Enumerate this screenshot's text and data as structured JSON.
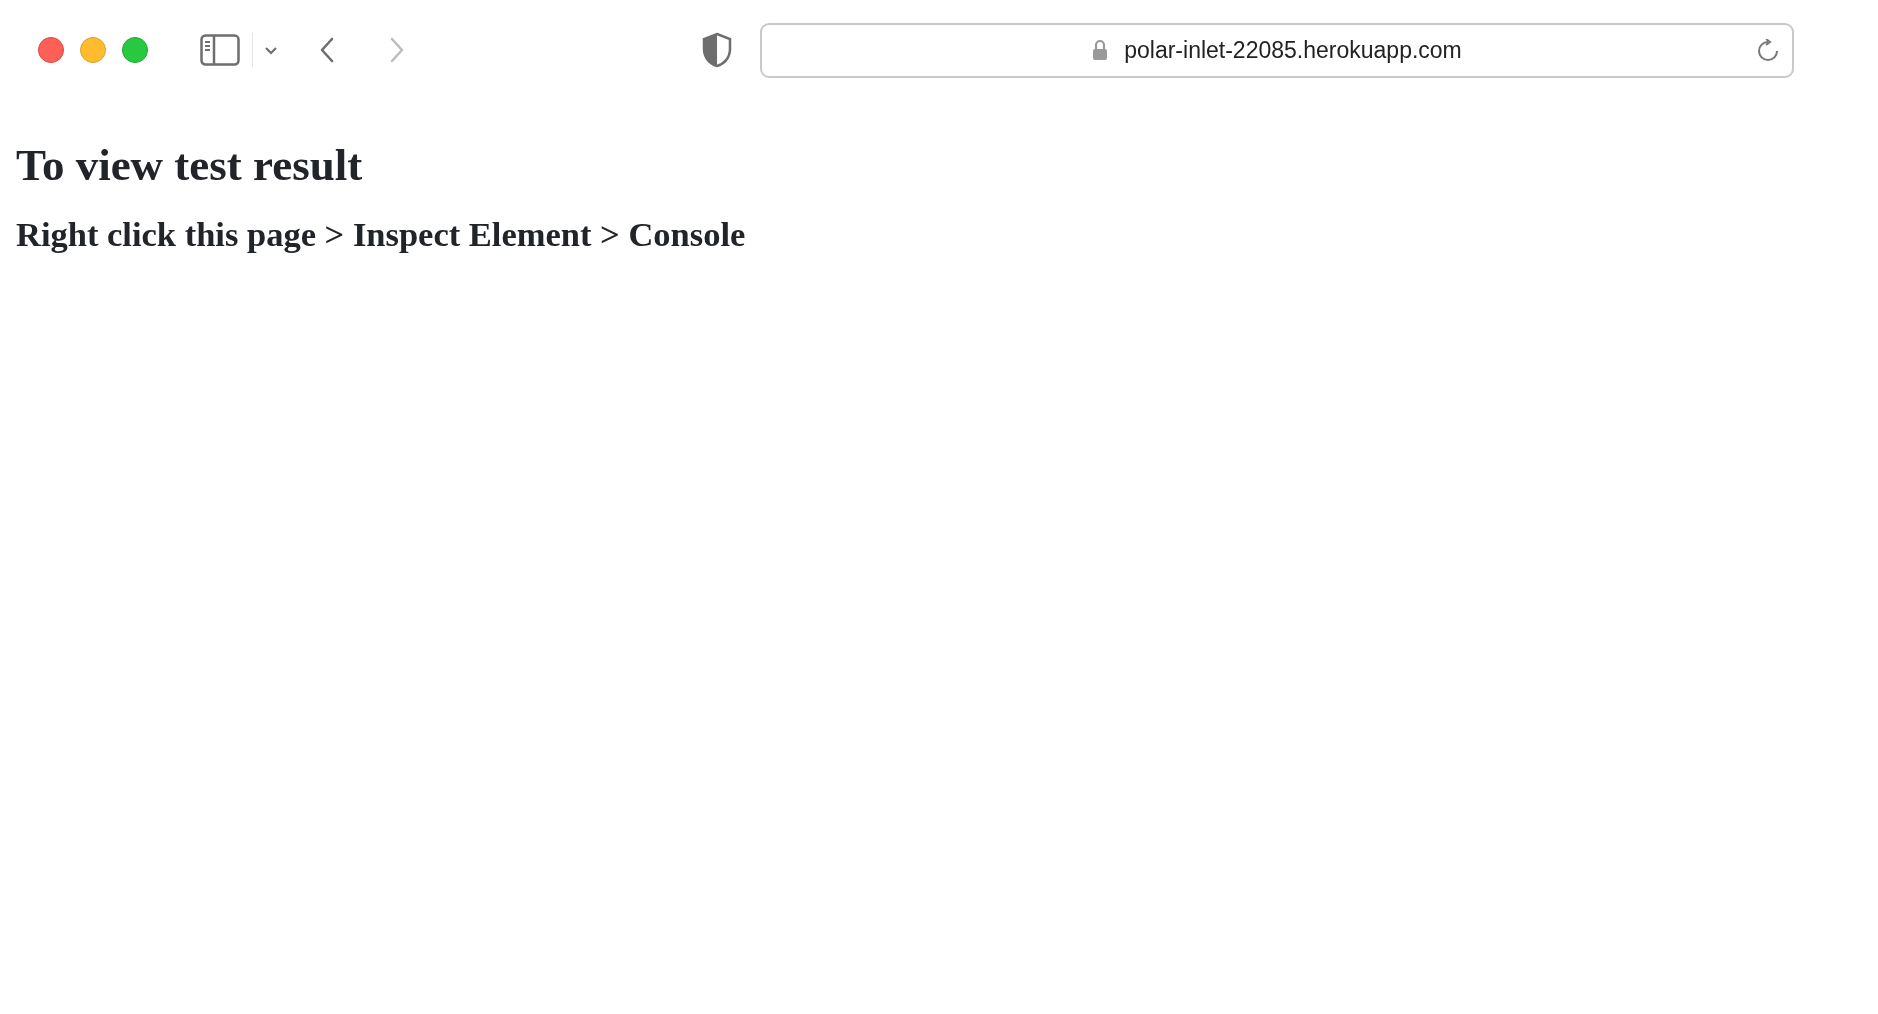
{
  "toolbar": {
    "nav_buttons": [
      {
        "kind": "back",
        "disabled": false
      },
      {
        "kind": "forward",
        "disabled": true
      }
    ],
    "address": "polar-inlet-22085.herokuapp.com"
  },
  "page": {
    "title": "To view test result",
    "subtitle": "Right click this page > Inspect Element > Console"
  }
}
